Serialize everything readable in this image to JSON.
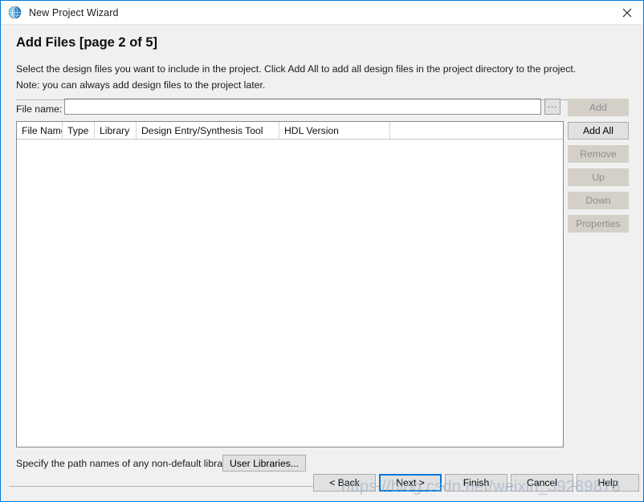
{
  "window": {
    "title": "New Project Wizard",
    "icon": "globe-icon",
    "close_label": "✕",
    "accent_color": "#0078d7",
    "face_color": "#f0f0f0"
  },
  "page": {
    "heading": "Add Files [page 2 of 5]",
    "intro_line_1": "Select the design files you want to include in the project. Click Add All to add all design files in the project directory to the project.",
    "intro_line_2": "Note: you can always add design files to the project later."
  },
  "file_name_row": {
    "label": "File name:",
    "value": "",
    "placeholder": "",
    "browse_label": "..."
  },
  "table": {
    "columns": [
      "File Name",
      "Type",
      "Library",
      "Design Entry/Synthesis Tool",
      "HDL Version",
      ""
    ],
    "rows": []
  },
  "side_buttons": [
    {
      "label": "Add",
      "enabled": false
    },
    {
      "label": "Add All",
      "enabled": true
    },
    {
      "label": "Remove",
      "enabled": false
    },
    {
      "label": "Up",
      "enabled": false
    },
    {
      "label": "Down",
      "enabled": false
    },
    {
      "label": "Properties",
      "enabled": false
    }
  ],
  "libraries": {
    "label": "Specify the path names of any non-default libraries.",
    "button_label": "User Libraries..."
  },
  "nav_buttons": {
    "back": "< Back",
    "next": "Next >",
    "finish": "Finish",
    "cancel": "Cancel",
    "help": "Help",
    "focused": "next"
  },
  "watermark": "https://blog.csdn.net/weixin_39289876"
}
